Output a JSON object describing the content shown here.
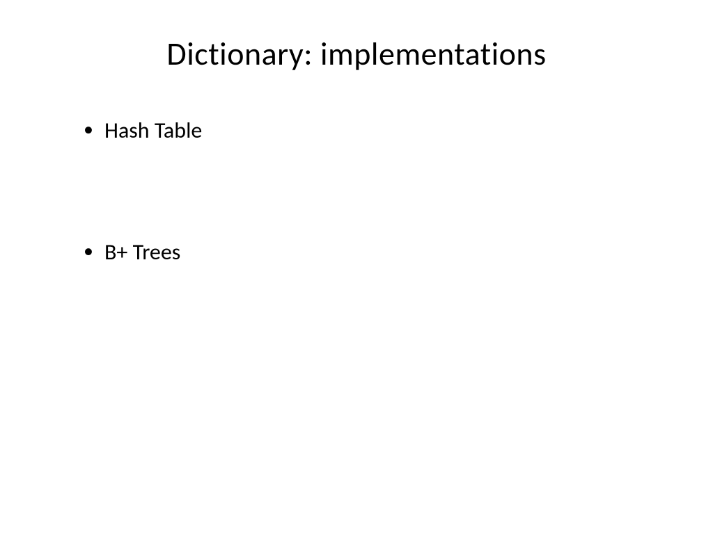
{
  "slide": {
    "title": "Dictionary: implementations",
    "bullets": [
      "Hash Table",
      "B+ Trees"
    ]
  }
}
